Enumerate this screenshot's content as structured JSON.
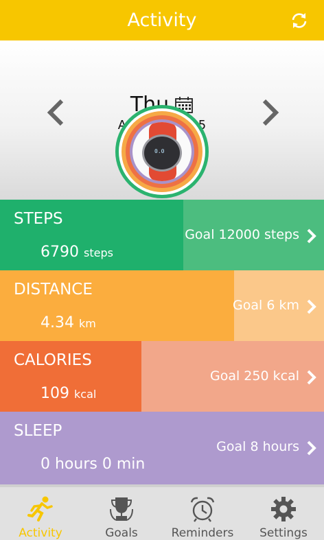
{
  "header": {
    "title": "Activity",
    "sync_icon": "sync-icon"
  },
  "date_nav": {
    "day": "Thu",
    "date": "Apr 2nd, 2015",
    "calendar_icon": "calendar-icon"
  },
  "device_display": {
    "screen_text": "0.0"
  },
  "metrics": [
    {
      "label": "STEPS",
      "value": "6790",
      "unit": "steps",
      "goal": "Goal 12000 steps",
      "progress": 0.566,
      "color": "#1fb06c"
    },
    {
      "label": "DISTANCE",
      "value": "4.34",
      "unit": "km",
      "goal": "Goal 6 km",
      "progress": 0.723,
      "color": "#fbad3e"
    },
    {
      "label": "CALORIES",
      "value": "109",
      "unit": "kcal",
      "goal": "Goal 250 kcal",
      "progress": 0.436,
      "color": "#f06e37"
    },
    {
      "label": "SLEEP",
      "value": "0 hours 0 min",
      "unit": "",
      "goal": "Goal 8 hours",
      "progress": 0,
      "color": "#ab95ca"
    }
  ],
  "tabs": [
    {
      "label": "Activity",
      "icon": "runner-icon",
      "active": true
    },
    {
      "label": "Goals",
      "icon": "trophy-icon",
      "active": false
    },
    {
      "label": "Reminders",
      "icon": "alarm-clock-icon",
      "active": false
    },
    {
      "label": "Settings",
      "icon": "gear-icon",
      "active": false
    }
  ],
  "colors": {
    "accent": "#f7c600",
    "header": "#f7c600"
  }
}
